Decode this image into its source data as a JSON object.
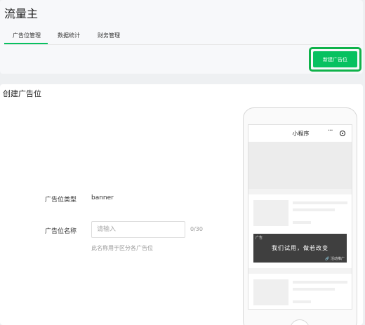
{
  "app": {
    "title": "流量主"
  },
  "tabs": [
    {
      "label": "广告位管理",
      "active": true
    },
    {
      "label": "数据统计",
      "active": false
    },
    {
      "label": "财务管理",
      "active": false
    }
  ],
  "actions": {
    "new_ad_slot": "新建广告位"
  },
  "section": {
    "title": "创建广告位"
  },
  "form": {
    "type_label": "广告位类型",
    "type_value": "banner",
    "name_label": "广告位名称",
    "name_placeholder": "请输入",
    "name_value": "",
    "name_counter": "0/30",
    "name_hint": "此名称用于区分各广告位"
  },
  "preview": {
    "nav_title": "小程序",
    "nav_more_icon": "more-dots-icon",
    "nav_close_icon": "target-close-icon",
    "ad_tag": "广告",
    "ad_text": "我们试用，做若改变",
    "ad_link": "🔗 活动推广"
  },
  "colors": {
    "accent": "#07c160",
    "highlight_border": "#0fb24a",
    "ad_bg": "#3f3f3f"
  }
}
